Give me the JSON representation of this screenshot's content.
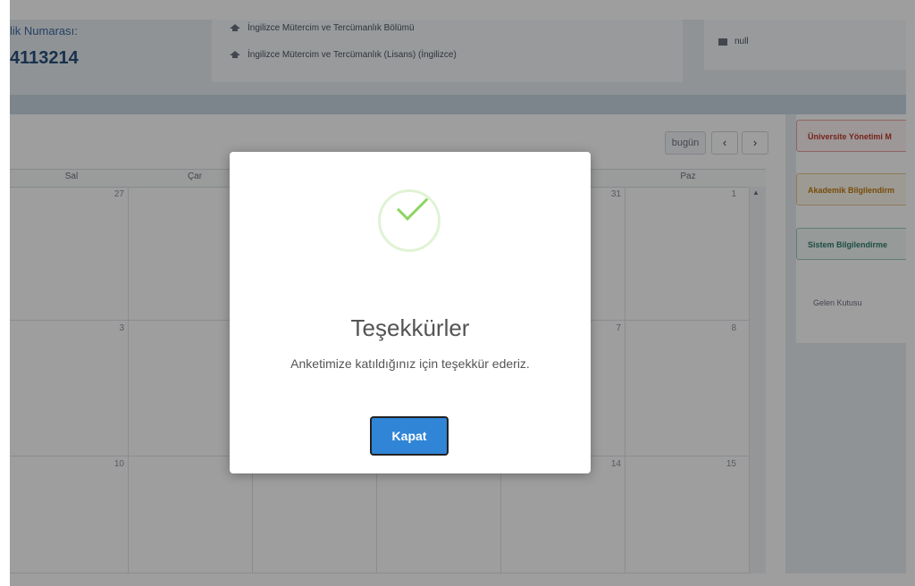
{
  "header": {
    "id_label": "lik Numarası:",
    "id_value": "4113214",
    "program_lines": [
      "İngilizce Mütercim ve Tercümanlık Bölümü",
      "İngilizce Mütercim ve Tercümanlık (Lisans) (İngilizce)"
    ],
    "contact_email": "null"
  },
  "calendar": {
    "today_label": "bugün",
    "prev_label": "‹",
    "next_label": "›",
    "day_names": [
      "Sal",
      "Çar",
      "",
      "",
      "",
      "Paz"
    ],
    "rows": [
      [
        "27",
        "",
        "",
        "",
        "31",
        "1"
      ],
      [
        "3",
        "",
        "",
        "",
        "7",
        "8"
      ],
      [
        "10",
        "",
        "",
        "",
        "14",
        "15"
      ]
    ]
  },
  "right_panel": {
    "buttons": [
      "Üniversite Yönetimi M",
      "Akademik Bilgilendirm",
      "Sistem Bilgilendirme"
    ],
    "inbox_label": "Gelen Kutusu"
  },
  "modal": {
    "title": "Teşekkürler",
    "message": "Anketimize katıldığınız için teşekkür ederiz.",
    "close_label": "Kapat",
    "icon": "check-icon",
    "accent_color": "#3085d6",
    "success_color": "#8ed462"
  }
}
